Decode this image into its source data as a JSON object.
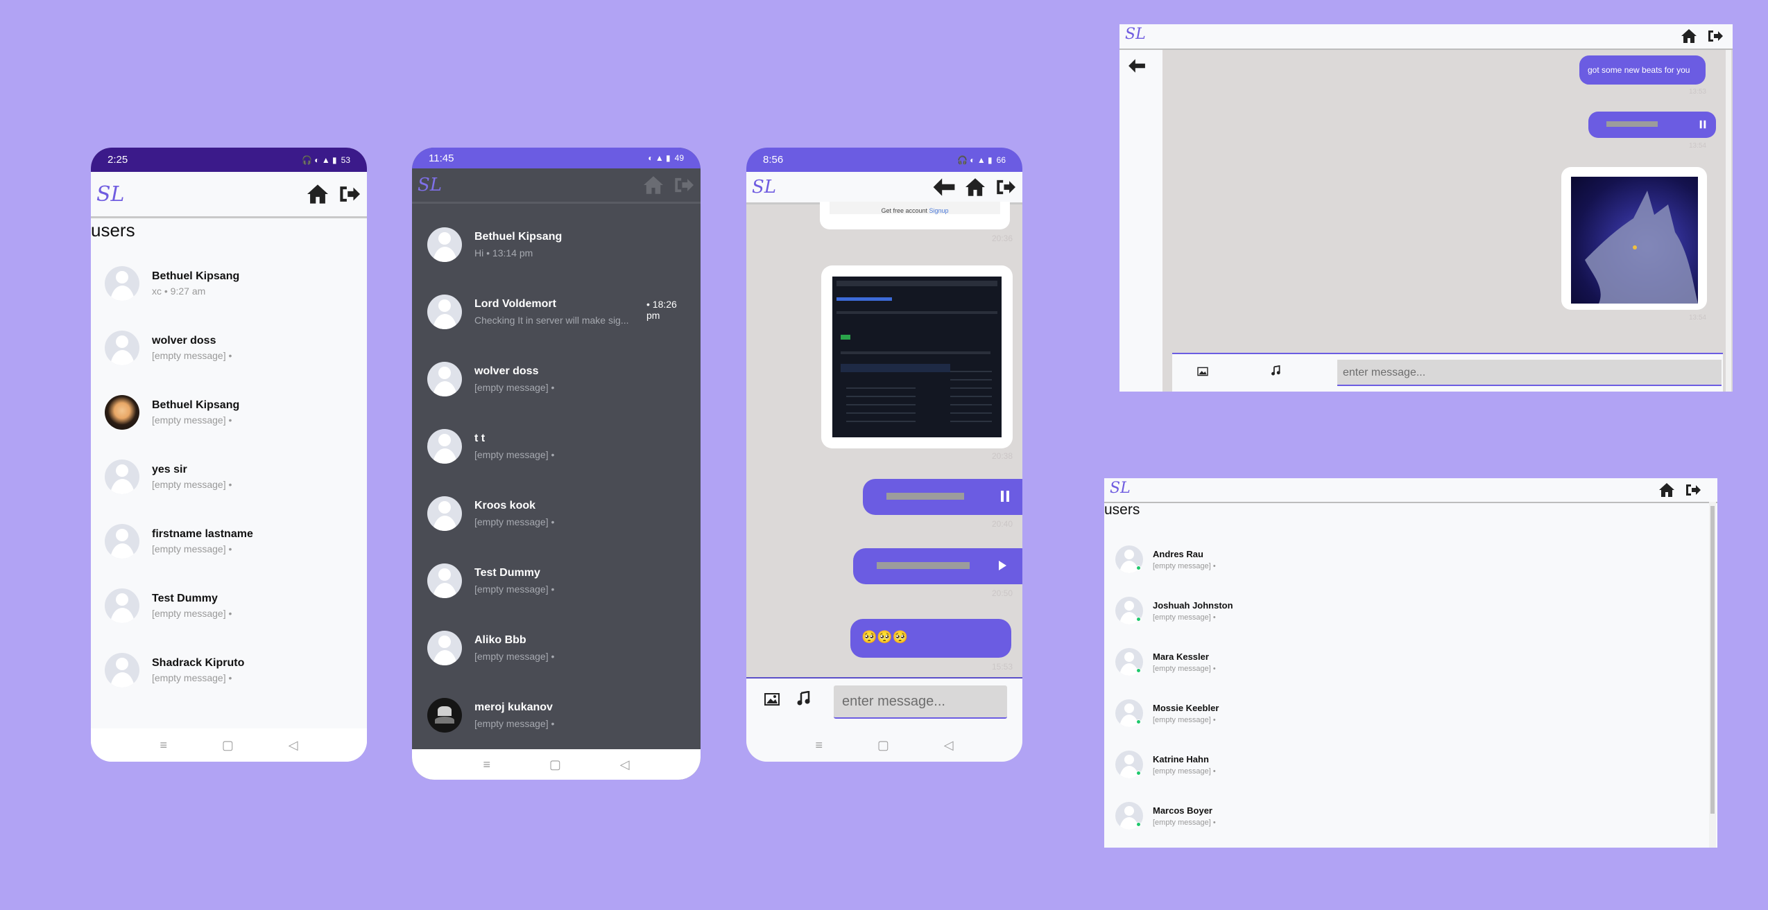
{
  "phone1": {
    "status_time": "2:25",
    "status_battery": "53",
    "logo": "SL",
    "title": "users",
    "users": [
      {
        "name": "Bethuel Kipsang",
        "sub": "xc • 9:27 am",
        "avatar": "default"
      },
      {
        "name": "wolver doss",
        "sub": "[empty message] •",
        "avatar": "default"
      },
      {
        "name": "Bethuel Kipsang",
        "sub": "[empty message] •",
        "avatar": "photo"
      },
      {
        "name": "yes sir",
        "sub": "[empty message] •",
        "avatar": "default"
      },
      {
        "name": "firstname lastname",
        "sub": "[empty message] •",
        "avatar": "default"
      },
      {
        "name": "Test Dummy",
        "sub": "[empty message] •",
        "avatar": "default"
      },
      {
        "name": "Shadrack Kipruto",
        "sub": "[empty message] •",
        "avatar": "default"
      }
    ]
  },
  "phone2": {
    "status_time": "11:45",
    "status_battery": "49",
    "logo": "SL",
    "chats": [
      {
        "name": "Bethuel Kipsang",
        "sub": "Hi • 13:14 pm",
        "time": ""
      },
      {
        "name": "Lord Voldemort",
        "sub": "Checking It in server will make sig...",
        "time": "• 18:26 pm"
      },
      {
        "name": "wolver doss",
        "sub": "[empty message] •",
        "time": ""
      },
      {
        "name": "t t",
        "sub": "[empty message] •",
        "time": ""
      },
      {
        "name": "Kroos kook",
        "sub": "[empty message] •",
        "time": ""
      },
      {
        "name": "Test Dummy",
        "sub": "[empty message] •",
        "time": ""
      },
      {
        "name": "Aliko Bbb",
        "sub": "[empty message] •",
        "time": ""
      },
      {
        "name": "meroj kukanov",
        "sub": "[empty message] •",
        "time": ""
      }
    ]
  },
  "phone3": {
    "status_time": "8:56",
    "status_battery": "66",
    "logo": "SL",
    "top_caption": "Get free account",
    "top_caption_link": "Signup",
    "times": [
      "20:36",
      "20:38",
      "20:40",
      "20:50",
      "15:53"
    ],
    "emoji_message": "🥺🥺🥺",
    "input_placeholder": "enter message..."
  },
  "desktop_chat": {
    "logo": "SL",
    "text_message": "got some new beats for you",
    "times": [
      "13:53",
      "13:54",
      "13:54"
    ],
    "input_placeholder": "enter message..."
  },
  "desktop_users": {
    "logo": "SL",
    "title": "users",
    "users": [
      {
        "name": "Andres Rau",
        "sub": "[empty message] •"
      },
      {
        "name": "Joshuah Johnston",
        "sub": "[empty message] •"
      },
      {
        "name": "Mara Kessler",
        "sub": "[empty message] •"
      },
      {
        "name": "Mossie Keebler",
        "sub": "[empty message] •"
      },
      {
        "name": "Katrine Hahn",
        "sub": "[empty message] •"
      },
      {
        "name": "Marcos Boyer",
        "sub": "[empty message] •"
      }
    ]
  },
  "colors": {
    "background": "#b1a3f4",
    "accent": "#6b5ce2",
    "statusbar_dark": "#3b1a8a",
    "dark_bg": "#4a4c54",
    "online": "#1fc86c"
  },
  "icons": [
    "home-icon",
    "logout-icon",
    "back-arrow-icon",
    "image-icon",
    "music-note-icon",
    "pause-icon",
    "play-icon"
  ]
}
